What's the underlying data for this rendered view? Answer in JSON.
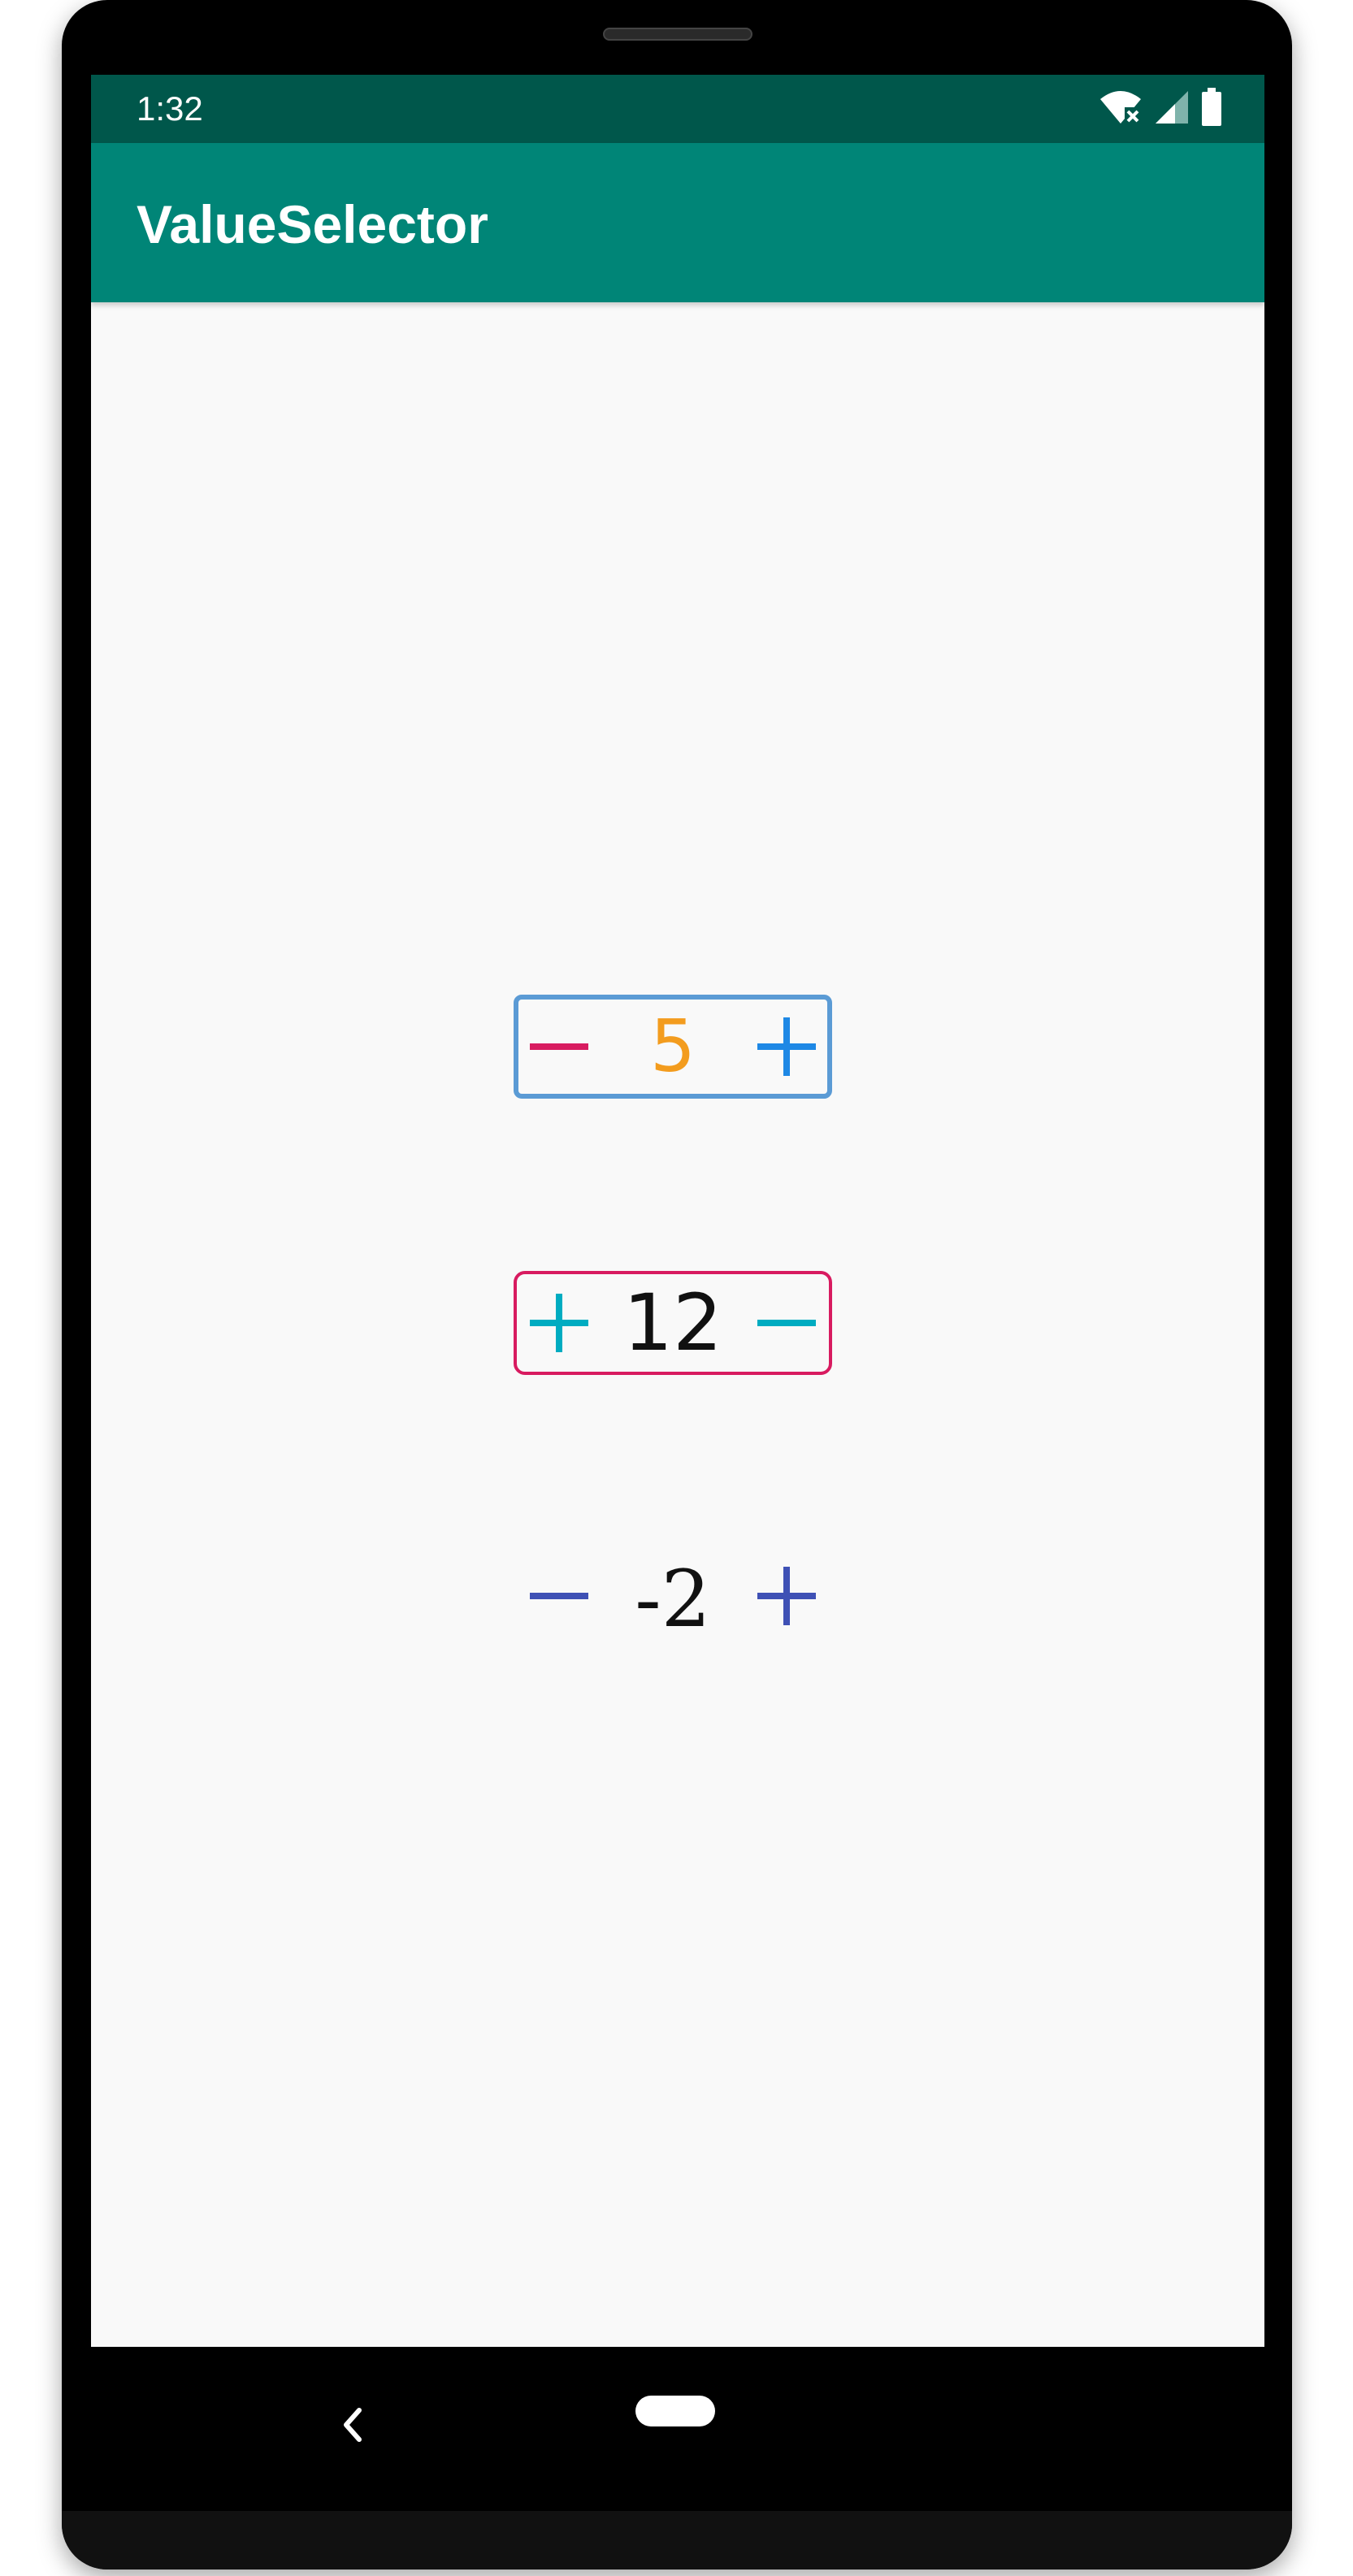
{
  "status_bar": {
    "time": "1:32",
    "icons": [
      "wifi-off-icon",
      "cellular-signal-icon",
      "battery-icon"
    ]
  },
  "app_bar": {
    "title": "ValueSelector"
  },
  "selectors": [
    {
      "value": "5",
      "left_button": "minus",
      "right_button": "plus",
      "border_color": "#5b9bd5",
      "value_color": "#f39c1e",
      "left_color": "#d81b60",
      "right_color": "#1e88e5"
    },
    {
      "value": "12",
      "left_button": "plus",
      "right_button": "minus",
      "border_color": "#d81b60",
      "value_color": "#111111",
      "left_color": "#00acc1",
      "right_color": "#00acc1"
    },
    {
      "value": "-2",
      "left_button": "minus",
      "right_button": "plus",
      "border_color": "none",
      "value_color": "#111111",
      "left_color": "#3f51b5",
      "right_color": "#3f51b5"
    }
  ],
  "nav_bar": {
    "icons": [
      "back-icon",
      "home-icon"
    ]
  }
}
